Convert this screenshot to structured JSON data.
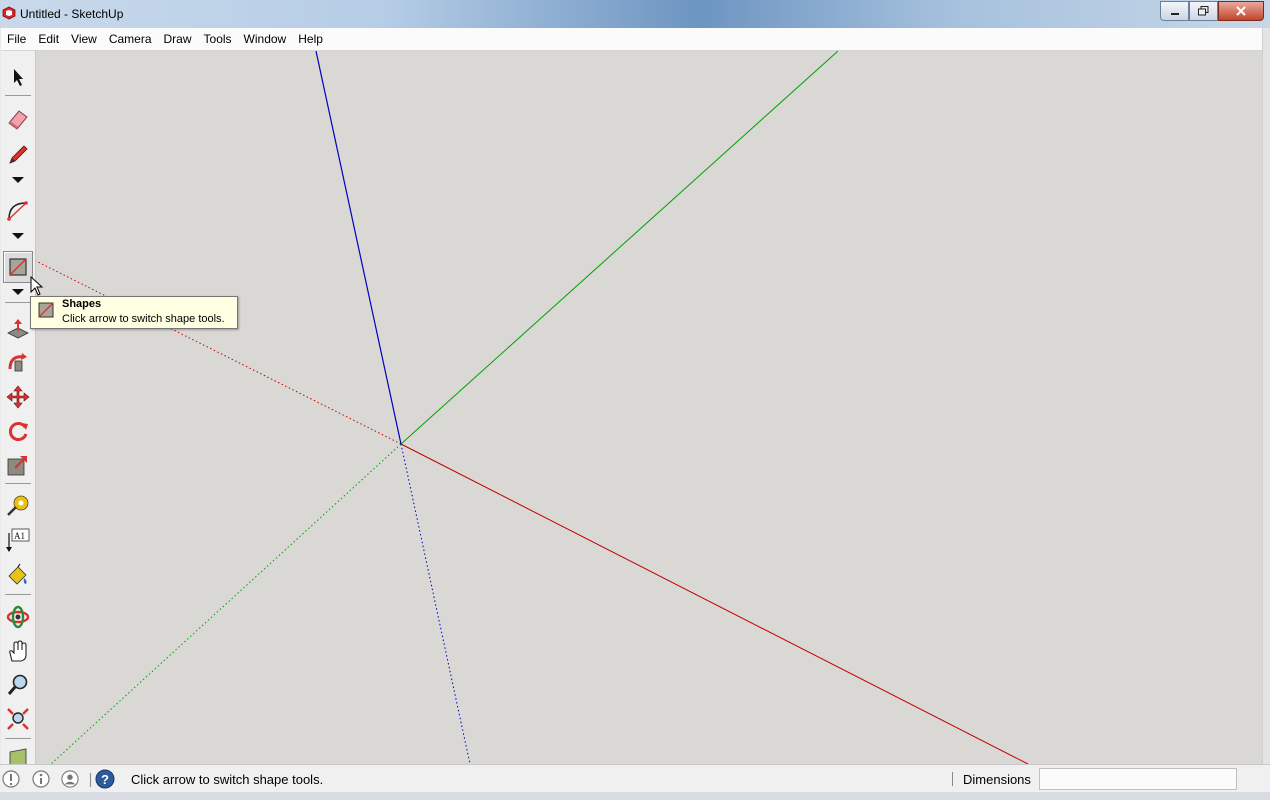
{
  "window": {
    "title": "Untitled - SketchUp"
  },
  "menubar": {
    "items": [
      "File",
      "Edit",
      "View",
      "Camera",
      "Draw",
      "Tools",
      "Window",
      "Help"
    ]
  },
  "toolbar": {
    "tools": [
      "select-icon",
      "eraser-icon",
      "pencil-icon",
      "arc-icon",
      "rectangle-icon",
      "push-pull-icon",
      "follow-me-icon",
      "move-icon",
      "rotate-icon",
      "scale-icon",
      "tape-measure-icon",
      "text-icon",
      "paint-bucket-icon",
      "orbit-icon",
      "pan-icon",
      "zoom-icon",
      "zoom-extents-icon",
      "section-plane-icon"
    ],
    "active_tool": "rectangle-icon"
  },
  "tooltip": {
    "title": "Shapes",
    "description": "Click arrow to switch shape tools."
  },
  "axes": {
    "red": "#c00000",
    "green": "#00a000",
    "blue": "#0000c0"
  },
  "statusbar": {
    "message": "Click arrow to switch shape tools.",
    "dimensions_label": "Dimensions",
    "dimensions_value": ""
  }
}
